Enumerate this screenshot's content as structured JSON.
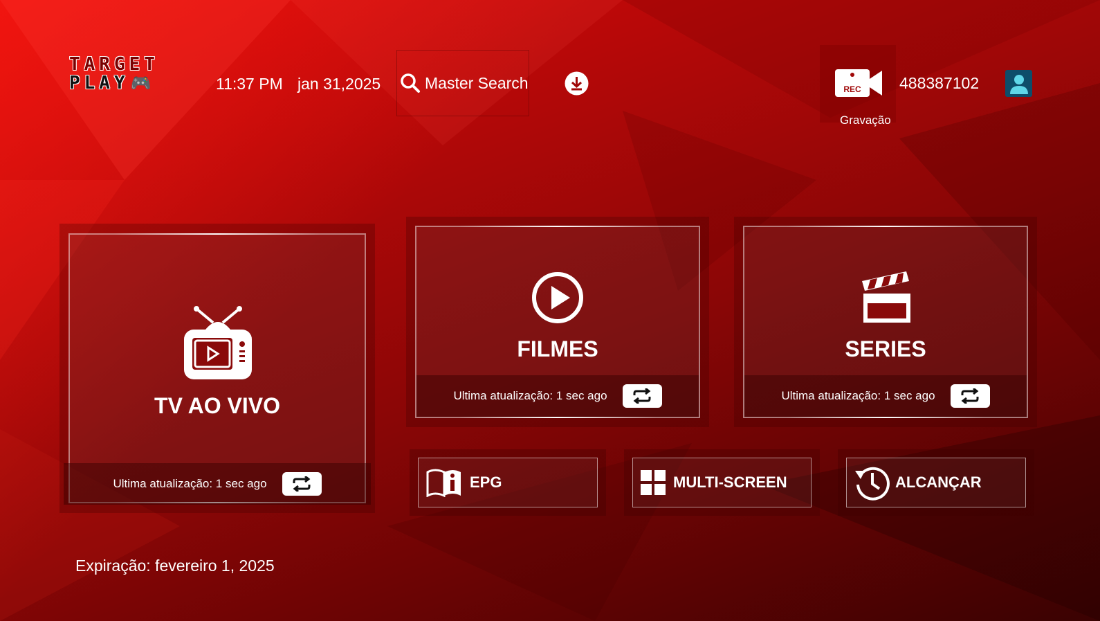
{
  "logo": {
    "line1": "TARGET",
    "line2": "PLAY"
  },
  "header": {
    "time": "11:37 PM",
    "date": "jan 31,2025",
    "search_label": "Master Search",
    "rec_badge": "REC",
    "rec_label": "Gravação",
    "user_id": "488387102"
  },
  "cards": {
    "live": {
      "title": "TV AO VIVO",
      "update": "Ultima atualização: 1 sec ago"
    },
    "movies": {
      "title": "FILMES",
      "update": "Ultima atualização: 1 sec ago"
    },
    "series": {
      "title": "SERIES",
      "update": "Ultima atualização: 1 sec ago"
    }
  },
  "buttons": {
    "epg": "EPG",
    "multiscreen": "MULTI-SCREEN",
    "catchup": "ALCANÇAR"
  },
  "footer": {
    "expiry": "Expiração: fevereiro 1, 2025"
  },
  "colors": {
    "background": "#b00808",
    "accent": "#ffffff",
    "avatar_bg": "#0d4d6a"
  }
}
